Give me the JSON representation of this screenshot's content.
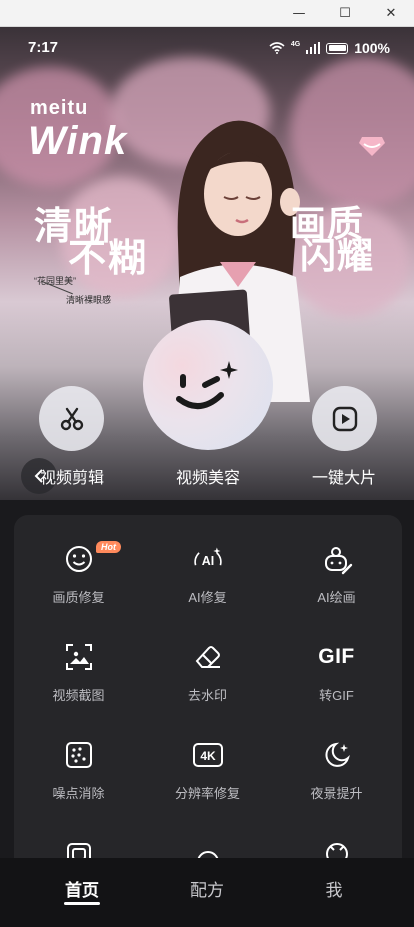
{
  "window": {
    "minimize": "—",
    "maximize": "☐",
    "close": "✕"
  },
  "status_bar": {
    "time": "7:17",
    "network": "4G",
    "battery": "100%"
  },
  "hero": {
    "brand_small": "meitu",
    "brand_big": "Wink",
    "left_title_line1": "清晰",
    "left_title_line2": "不糊",
    "right_title_line1": "画质",
    "right_title_line2": "闪耀",
    "caption_1": "“花园里美”",
    "caption_2": "清晰裸眼感"
  },
  "actions": {
    "left_label": "视频剪辑",
    "center_label": "视频美容",
    "right_label": "一键大片"
  },
  "tools": {
    "hot_badge": "Hot",
    "items": [
      {
        "label": "画质修复",
        "icon": "smile-face-icon"
      },
      {
        "label": "AI修复",
        "icon": "ai-sparkle-icon"
      },
      {
        "label": "AI绘画",
        "icon": "ai-paint-icon"
      },
      {
        "label": "视频截图",
        "icon": "screenshot-icon"
      },
      {
        "label": "去水印",
        "icon": "eraser-icon"
      },
      {
        "label": "转GIF",
        "icon": "gif-icon",
        "icon_text": "GIF"
      },
      {
        "label": "噪点消除",
        "icon": "noise-icon"
      },
      {
        "label": "分辨率修复",
        "icon": "4k-icon",
        "icon_text": "4K"
      },
      {
        "label": "夜景提升",
        "icon": "moon-icon"
      }
    ]
  },
  "nav": {
    "items": [
      {
        "label": "首页",
        "active": true
      },
      {
        "label": "配方",
        "active": false
      },
      {
        "label": "我",
        "active": false
      }
    ]
  },
  "colors": {
    "accent": "#ff8a5c",
    "panel": "#262629",
    "background": "#1a1a1d"
  }
}
